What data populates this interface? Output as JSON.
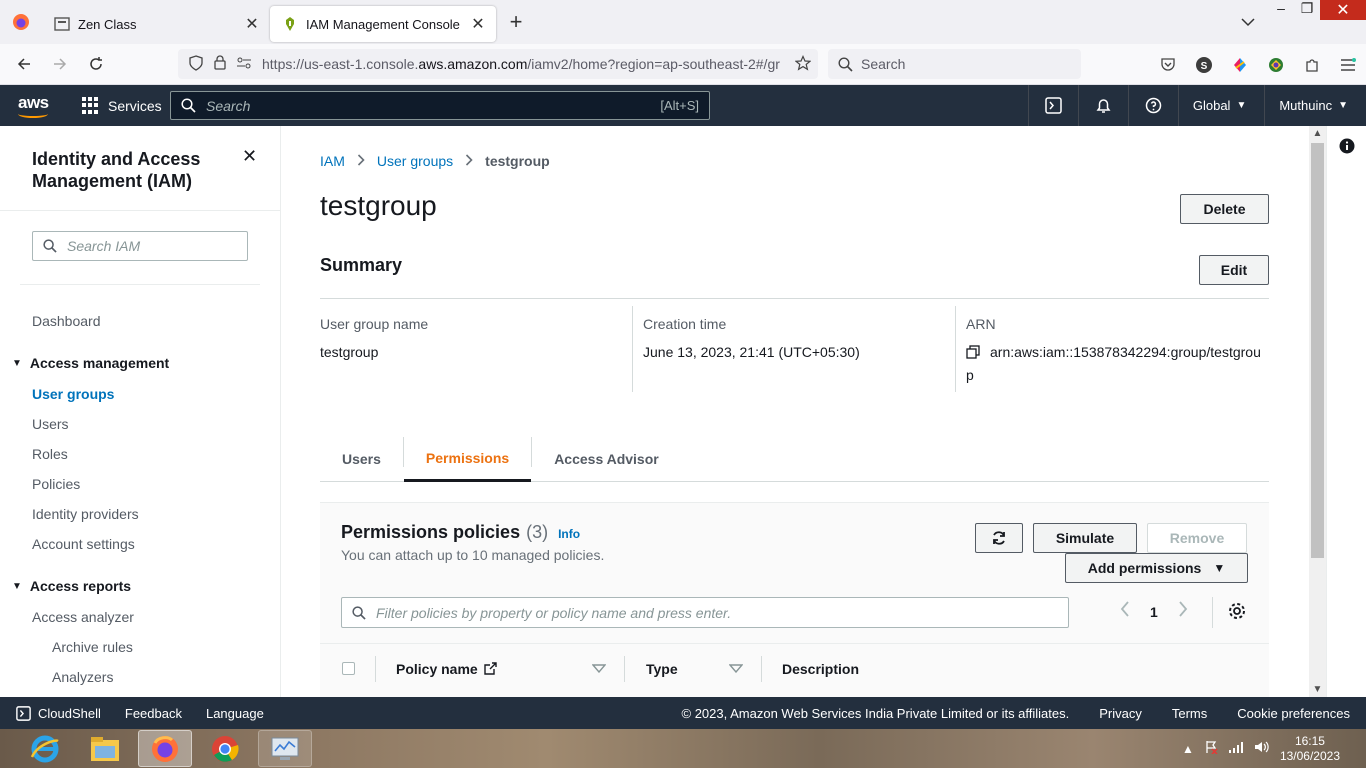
{
  "browser": {
    "tabs": [
      {
        "label": "Zen Class",
        "active": false
      },
      {
        "label": "IAM Management Console",
        "active": true
      }
    ],
    "url_prefix": "https://us-east-1.console.",
    "url_domain": "aws.amazon.com",
    "url_suffix": "/iamv2/home?region=ap-southeast-2#/gr",
    "search_placeholder": "Search"
  },
  "aws_nav": {
    "logo": "aws",
    "services_label": "Services",
    "search_placeholder": "Search",
    "search_shortcut": "[Alt+S]",
    "region": "Global",
    "account": "Muthuinc"
  },
  "sidebar": {
    "title": "Identity and Access Management (IAM)",
    "search_placeholder": "Search IAM",
    "dashboard": "Dashboard",
    "access_management": {
      "label": "Access management",
      "items": [
        "User groups",
        "Users",
        "Roles",
        "Policies",
        "Identity providers",
        "Account settings"
      ],
      "active": "User groups"
    },
    "access_reports": {
      "label": "Access reports",
      "items": [
        "Access analyzer"
      ],
      "sub_items": [
        "Archive rules",
        "Analyzers"
      ]
    }
  },
  "main": {
    "breadcrumb": [
      "IAM",
      "User groups",
      "testgroup"
    ],
    "title": "testgroup",
    "delete_label": "Delete",
    "summary": {
      "title": "Summary",
      "edit_label": "Edit",
      "group_name_label": "User group name",
      "group_name_value": "testgroup",
      "creation_label": "Creation time",
      "creation_value": "June 13, 2023, 21:41 (UTC+05:30)",
      "arn_label": "ARN",
      "arn_value_line1": "arn:aws:iam::153878342294:group/testgrou",
      "arn_value_line2": "p"
    },
    "tabs": [
      "Users",
      "Permissions",
      "Access Advisor"
    ],
    "active_tab": "Permissions",
    "permissions": {
      "title": "Permissions policies",
      "count": "(3)",
      "info": "Info",
      "subtitle": "You can attach up to 10 managed policies.",
      "simulate_label": "Simulate",
      "remove_label": "Remove",
      "add_label": "Add permissions",
      "filter_placeholder": "Filter policies by property or policy name and press enter.",
      "page": "1",
      "columns": [
        "Policy name",
        "Type",
        "Description"
      ]
    }
  },
  "footer": {
    "cloudshell": "CloudShell",
    "feedback": "Feedback",
    "language": "Language",
    "copyright": "© 2023, Amazon Web Services India Private Limited or its affiliates.",
    "privacy": "Privacy",
    "terms": "Terms",
    "cookies": "Cookie preferences"
  },
  "taskbar": {
    "time": "16:15",
    "date": "13/06/2023"
  },
  "colors": {
    "aws_nav": "#232f3e",
    "link": "#0073bb",
    "accent_orange": "#ec7211",
    "aws_orange": "#ff9900"
  }
}
